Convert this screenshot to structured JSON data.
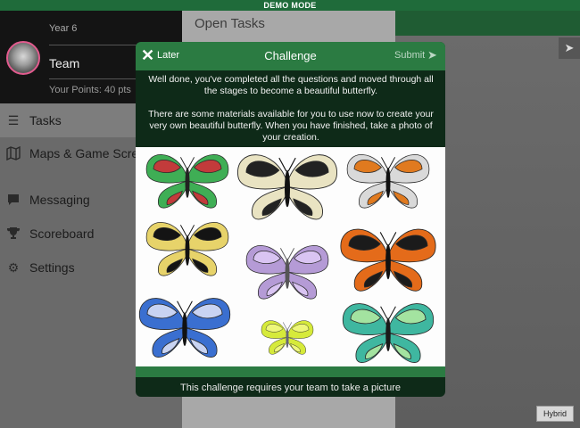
{
  "banner": {
    "text": "DEMO MODE"
  },
  "profile": {
    "year": "Year 6",
    "team": "Team",
    "points": "Your Points: 40 pts"
  },
  "nav": {
    "items": [
      {
        "label": "Tasks",
        "icon": "list-icon",
        "selected": true
      },
      {
        "label": "Maps & Game Screens",
        "icon": "map-icon",
        "selected": false
      },
      {
        "label": "Messaging",
        "icon": "chat-icon",
        "selected": false
      },
      {
        "label": "Scoreboard",
        "icon": "trophy-icon",
        "selected": false
      },
      {
        "label": "Settings",
        "icon": "gear-icon",
        "selected": false
      }
    ]
  },
  "tasks_panel": {
    "title": "Open Tasks"
  },
  "map": {
    "hybrid_label": "Hybrid",
    "location_icon": "location-arrow-icon"
  },
  "modal": {
    "later_label": "Later",
    "title": "Challenge",
    "submit_label": "Submit",
    "message_1": "Well done, you've completed all the questions and moved through all the stages to become a beautiful butterfly.",
    "message_2": "There are some materials available for you to use now to create your very own beautiful butterfly. When you have finished, take a photo of your creation.",
    "footer": "This challenge requires your team to take a picture",
    "butterflies": [
      {
        "name": "green-red-butterfly",
        "wing": "#3fae55",
        "accent": "#c23b3b",
        "body": "#222"
      },
      {
        "name": "swallowtail-butterfly",
        "wing": "#e9e3c2",
        "accent": "#222222",
        "body": "#111"
      },
      {
        "name": "eyespot-butterfly",
        "wing": "#d9d9d9",
        "accent": "#e07a1f",
        "body": "#111"
      },
      {
        "name": "yellow-black-butterfly",
        "wing": "#e7d36a",
        "accent": "#141414",
        "body": "#111"
      },
      {
        "name": "lilac-butterfly",
        "wing": "#b59bd6",
        "accent": "#d9c4f2",
        "body": "#555"
      },
      {
        "name": "orange-monarch-butterfly",
        "wing": "#e46b1a",
        "accent": "#1b1b1b",
        "body": "#111"
      },
      {
        "name": "blue-morpho-butterfly",
        "wing": "#3a6fd0",
        "accent": "#c8d3f2",
        "body": "#111"
      },
      {
        "name": "lime-butterfly",
        "wing": "#d6ea3a",
        "accent": "#eef77a",
        "body": "#667"
      },
      {
        "name": "teal-butterfly",
        "wing": "#3fb7a0",
        "accent": "#a3e3a0",
        "body": "#1a1a1a"
      }
    ]
  },
  "colors": {
    "accent": "#2b7b42",
    "banner": "#1f6b3a",
    "modal_bg": "#0e2a18",
    "avatar_ring": "#e25b8e"
  }
}
